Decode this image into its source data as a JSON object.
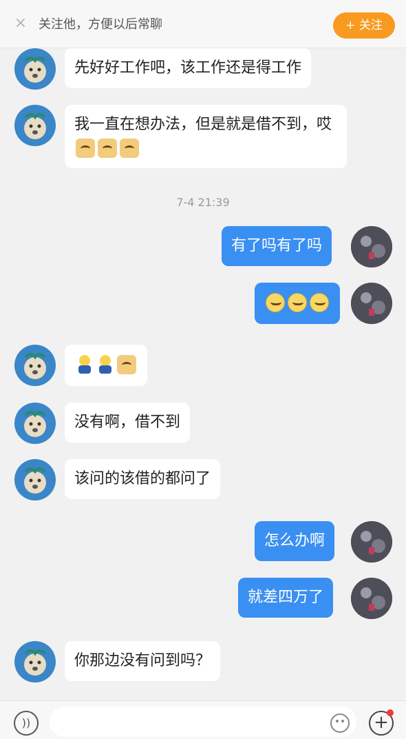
{
  "banner": {
    "close_icon": "close-icon",
    "text": "关注他，方便以后常聊",
    "follow_label": "+ 关注",
    "follow_color": "#f99a20"
  },
  "timestamp": "7-4 21:39",
  "messages": [
    {
      "side": "in",
      "text": "先好好工作吧，该工作还是得工作"
    },
    {
      "side": "in",
      "text": "我一直在想办法，但是就是借不到，哎",
      "emojis": [
        "dog-emoji",
        "dog-emoji",
        "dog-emoji"
      ]
    },
    {
      "side": "out",
      "text": "有了吗有了吗"
    },
    {
      "side": "out",
      "text": "",
      "emojis": [
        "sad-face-emoji",
        "sad-face-emoji",
        "sad-face-emoji"
      ]
    },
    {
      "side": "in",
      "text": "",
      "emojis": [
        "kneel-emoji",
        "kneel-emoji",
        "dog-emoji"
      ]
    },
    {
      "side": "in",
      "text": "没有啊，借不到"
    },
    {
      "side": "in",
      "text": "该问的该借的都问了"
    },
    {
      "side": "out",
      "text": "怎么办啊"
    },
    {
      "side": "out",
      "text": "就差四万了"
    },
    {
      "side": "in",
      "text": "你那边没有问到吗？"
    }
  ],
  "colors": {
    "outgoing_bubble": "#3a8ff2",
    "incoming_bubble": "#ffffff",
    "background": "#f1f1f2"
  },
  "input_bar": {
    "voice_icon": "voice-icon",
    "emoji_icon": "emoji-icon",
    "plus_icon": "plus-icon"
  }
}
